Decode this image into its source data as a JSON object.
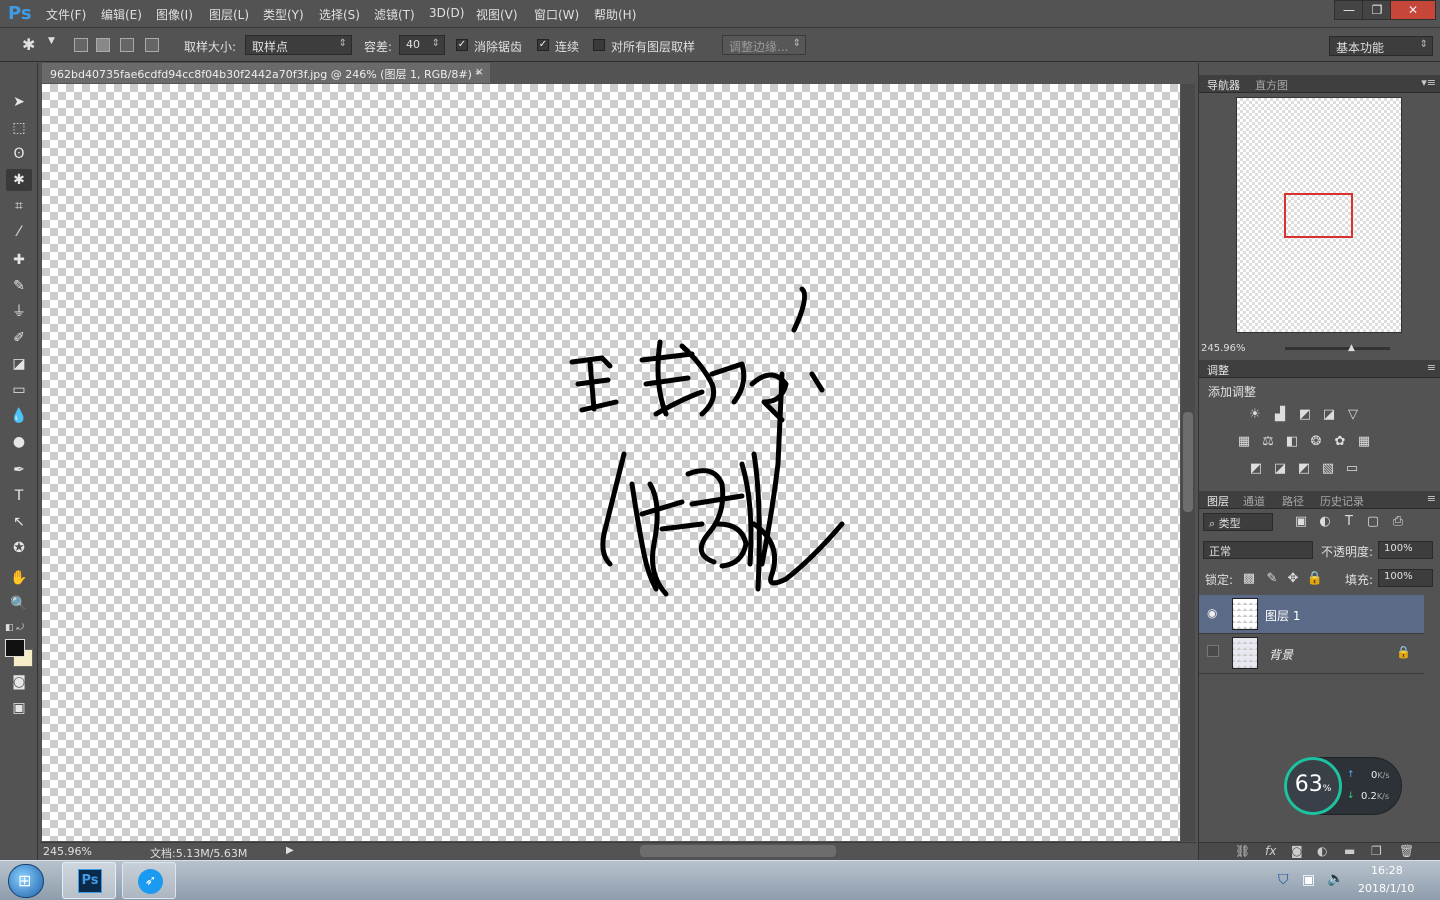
{
  "app": {
    "logo": "Ps",
    "menu": [
      "文件(F)",
      "编辑(E)",
      "图像(I)",
      "图层(L)",
      "类型(Y)",
      "选择(S)",
      "滤镜(T)",
      "3D(D)",
      "视图(V)",
      "窗口(W)",
      "帮助(H)"
    ],
    "window_buttons": [
      "—",
      "❐",
      "✕"
    ]
  },
  "options": {
    "sample_size_label": "取样大小:",
    "sample_size_value": "取样点",
    "tolerance_label": "容差:",
    "tolerance_value": "40",
    "antialias_label": "消除锯齿",
    "antialias_checked": true,
    "contiguous_label": "连续",
    "contiguous_checked": true,
    "all_layers_label": "对所有图层取样",
    "all_layers_checked": false,
    "refine_edge_label": "调整边缘...",
    "workspace_value": "基本功能"
  },
  "document": {
    "tab_title": "962bd40735fae6cdfd94cc8f04b30f2442a70f3f.jpg @ 246% (图层 1, RGB/8#) *",
    "close_glyph": "×",
    "zoom": "245.96%",
    "doc_size": "文档:5.13M/5.63M"
  },
  "navigator": {
    "tabs": [
      "导航器",
      "直方图"
    ],
    "zoom": "245.96%"
  },
  "adjustments": {
    "tab": "调整",
    "add_label": "添加调整"
  },
  "layers": {
    "tabs": [
      "图层",
      "通道",
      "路径",
      "历史记录"
    ],
    "filter_kind": "类型",
    "blend_mode": "正常",
    "opacity_label": "不透明度:",
    "opacity_value": "100%",
    "lock_label": "锁定:",
    "fill_label": "填充:",
    "fill_value": "100%",
    "items": [
      {
        "name": "图层 1",
        "visible": true,
        "selected": true,
        "locked": false
      },
      {
        "name": "背景",
        "visible": false,
        "selected": false,
        "locked": true
      }
    ]
  },
  "network_widget": {
    "percent": "63",
    "percent_sign": "%",
    "upload": "0",
    "upload_unit": "K/s",
    "download": "0.2",
    "download_unit": "K/s"
  },
  "taskbar": {
    "time": "16:28",
    "date": "2018/1/10",
    "ps_label": "Ps"
  },
  "colors": {
    "accent": "#3f9ce4",
    "selected_layer": "#5b6b87",
    "nav_box": "#d93030",
    "widget_ring": "#1fc2a0"
  }
}
